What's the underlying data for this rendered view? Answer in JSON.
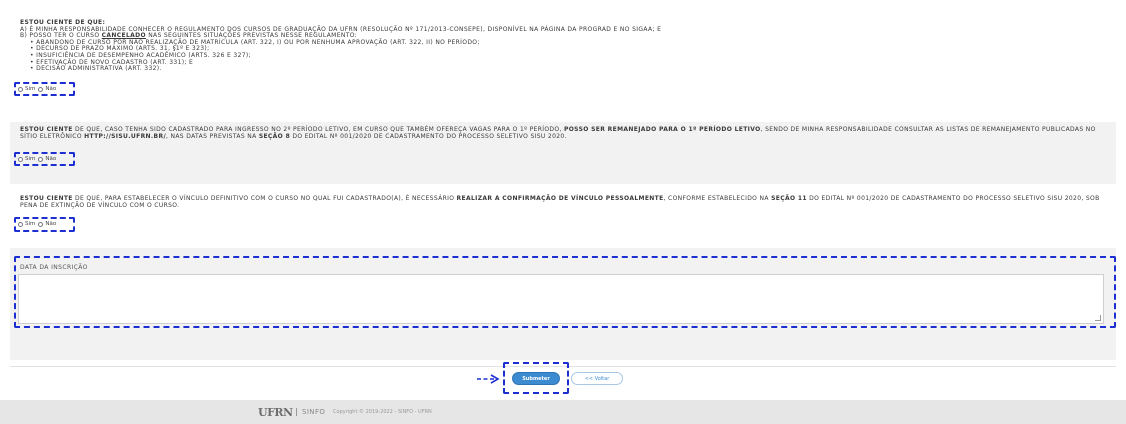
{
  "section1": {
    "title": "ESTOU CIENTE DE QUE:",
    "line_a": "A) É MINHA RESPONSABILIDADE CONHECER O REGULAMENTO DOS CURSOS DE GRADUAÇÃO DA UFRN (RESOLUÇÃO Nº 171/2013-CONSEPE), DISPONÍVEL NA PÁGINA DA PROGRAD E NO SIGAA; E",
    "line_b_pre": "B) POSSO TER O CURSO ",
    "line_b_bold": "CANCELADO",
    "line_b_post": " NAS SEGUINTES SITUAÇÕES PREVISTAS NESSE REGULAMENTO:",
    "items": [
      "• ABANDONO DE CURSO POR NÃO REALIZAÇÃO DE MATRÍCULA (ART. 322, I) OU POR NENHUMA APROVAÇÃO (ART. 322, II) NO PERÍODO;",
      "• DECURSO DE PRAZO MÁXIMO (ARTS. 31, §1º E 323);",
      "• INSUFICIÊNCIA DE DESEMPENHO ACADÊMICO (ARTS. 326 E 327);",
      "• EFETIVAÇÃO DE NOVO CADASTRO (ART. 331); E",
      "• DECISÃO ADMINISTRATIVA (ART. 332)."
    ]
  },
  "section2": {
    "bold1": "ESTOU CIENTE",
    "t1": " DE QUE, CASO TENHA SIDO CADASTRADO PARA INGRESSO NO 2º PERÍODO LETIVO, EM CURSO QUE TAMBÉM OFEREÇA VAGAS PARA O 1º PERÍODO, ",
    "bold2": "POSSO SER REMANEJADO PARA O 1º PERÍODO LETIVO",
    "t2": ", SENDO DE MINHA RESPONSABILIDADE CONSULTAR AS LISTAS DE REMANEJAMENTO PUBLICADAS NO SÍTIO ELETRÔNICO ",
    "bold3": "HTTP://SISU.UFRN.BR/",
    "t3": ", NAS DATAS PREVISTAS NA ",
    "bold4": "SEÇÃO 8",
    "t4": " DO EDITAL Nº 001/2020 DE CADASTRAMENTO DO PROCESSO SELETIVO SISU 2020."
  },
  "section3": {
    "bold1": "ESTOU CIENTE",
    "t1": " DE QUE, PARA ESTABELECER O VÍNCULO DEFINITIVO COM O CURSO NO QUAL FUI CADASTRADO(A), É NECESSÁRIO ",
    "bold2": "REALIZAR A CONFIRMAÇÃO DE VÍNCULO PESSOALMENTE",
    "t2": ", CONFORME ESTABELECIDO NA ",
    "bold3": "SEÇÃO 11",
    "t3": " DO EDITAL Nº 001/2020 DE CADASTRAMENTO DO PROCESSO SELETIVO SISU 2020, SOB PENA DE EXTINÇÃO DE VÍNCULO COM O CURSO."
  },
  "radio": {
    "yes": "Sim",
    "no": "Não"
  },
  "form": {
    "date_label": "DATA DA INSCRIÇÃO",
    "date_value": ""
  },
  "buttons": {
    "submit": "Submeter",
    "back": "<< Voltar"
  },
  "footer": {
    "logo": "UFRN",
    "system": "SINFO",
    "copyright": "Copyright © 2019-2022 - SINFO - UFRN"
  },
  "colors": {
    "highlight": "#1d2fd0",
    "button": "#3c8bd1",
    "section_bg": "#f2f2f2"
  },
  "icons": {
    "annotation_arrow": "arrow-right-icon",
    "radio": "radio-icon",
    "resize": "resize-handle-icon"
  }
}
